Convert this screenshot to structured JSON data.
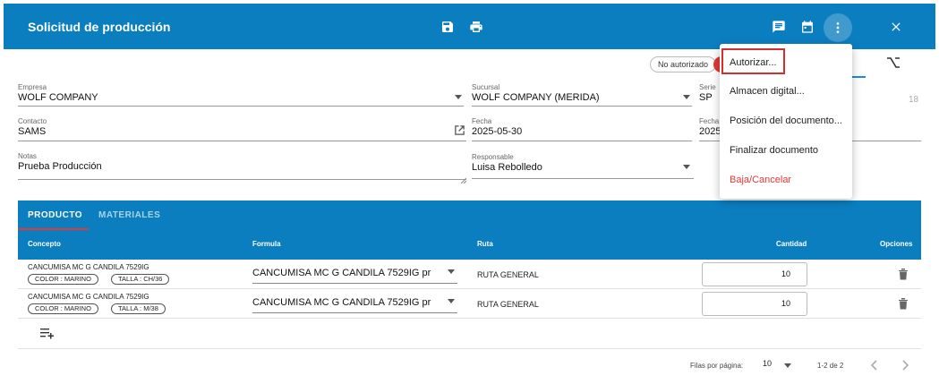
{
  "header": {
    "title": "Solicitud de producción"
  },
  "status": {
    "label": "No autorizado",
    "color": "#e53935"
  },
  "form": {
    "empresa": {
      "label": "Empresa",
      "value": "WOLF COMPANY"
    },
    "sucursal": {
      "label": "Sucursal",
      "value": "WOLF COMPANY (MERIDA)"
    },
    "serie": {
      "label": "Serie",
      "value": "SP",
      "number": "18"
    },
    "contacto": {
      "label": "Contacto",
      "value": "SAMS"
    },
    "fecha": {
      "label": "Fecha",
      "value": "2025-05-30"
    },
    "fecha2": {
      "label": "Fecha",
      "value": "2025"
    },
    "notas": {
      "label": "Notas",
      "value": "Prueba Producción"
    },
    "responsable": {
      "label": "Responsable",
      "value": "Luisa Rebolledo"
    }
  },
  "tabs": [
    {
      "label": "PRODUCTO",
      "active": true
    },
    {
      "label": "MATERIALES",
      "active": false
    }
  ],
  "columns": {
    "concepto": "Concepto",
    "formula": "Formula",
    "ruta": "Ruta",
    "cantidad": "Cantidad",
    "opciones": "Opciones"
  },
  "rows": [
    {
      "concept": "CANCUMISA MC G CANDILA 7529IG",
      "chips": [
        "COLOR : MARINO",
        "TALLA : CH/36"
      ],
      "formula": "CANCUMISA MC G CANDILA 7529IG pr",
      "ruta": "RUTA GENERAL",
      "cantidad": "10"
    },
    {
      "concept": "CANCUMISA MC G CANDILA 7529IG",
      "chips": [
        "COLOR : MARINO",
        "TALLA : M/38"
      ],
      "formula": "CANCUMISA MC G CANDILA 7529IG pr",
      "ruta": "RUTA GENERAL",
      "cantidad": "10"
    }
  ],
  "pagination": {
    "rows_per_page_label": "Filas por página:",
    "rows_per_page": "10",
    "range": "1-2 de 2"
  },
  "menu": {
    "items": [
      {
        "label": "Autorizar..."
      },
      {
        "label": "Almacen digital..."
      },
      {
        "label": "Posición del documento..."
      },
      {
        "label": "Finalizar documento"
      },
      {
        "label": "Baja/Cancelar",
        "danger": true
      }
    ]
  },
  "icons": {
    "save": "save-icon",
    "print": "print-icon",
    "comment": "comment-icon",
    "calendar": "calendar-icon",
    "more": "more-vert-icon",
    "close": "close-icon"
  }
}
